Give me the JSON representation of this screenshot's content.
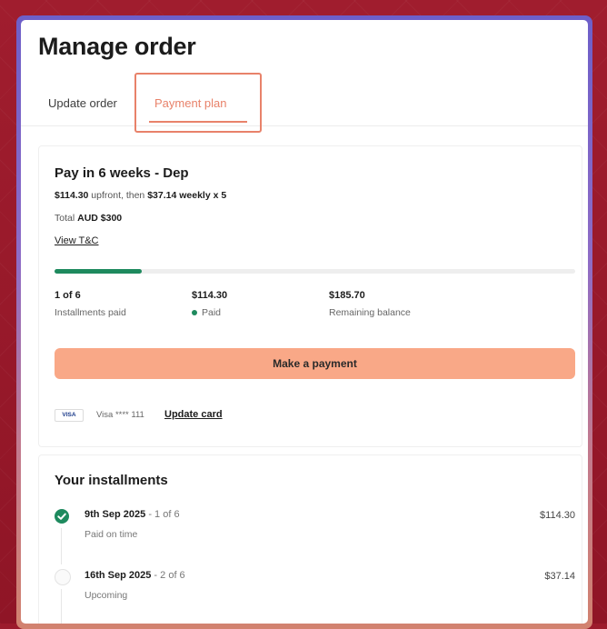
{
  "page": {
    "title": "Manage order"
  },
  "tabs": [
    {
      "label": "Update order",
      "active": false
    },
    {
      "label": "Payment plan",
      "active": true
    }
  ],
  "plan": {
    "title": "Pay in 6 weeks - Dep",
    "upfront_amount": "$114.30",
    "upfront_text": " upfront, then ",
    "weekly_text": "$37.14 weekly x 5",
    "total_prefix": "Total ",
    "total_value": "AUD $300",
    "tnc_link": "View T&C",
    "progress_fraction": 0.1667,
    "stats": [
      {
        "value": "1 of 6",
        "label": "Installments paid"
      },
      {
        "value": "$114.30",
        "label": "Paid"
      },
      {
        "value": "$185.70",
        "label": "Remaining balance"
      }
    ],
    "pay_button": "Make a payment",
    "card_brand": "VISA",
    "card_number": "Visa **** 111",
    "update_card_link": "Update card"
  },
  "installments": {
    "title": "Your installments",
    "items": [
      {
        "date": "9th Sep 2025",
        "sep": " - ",
        "count": "1 of 6",
        "status": "Paid on time",
        "amount": "$114.30",
        "paid": true
      },
      {
        "date": "16th Sep 2025",
        "sep": " - ",
        "count": "2 of 6",
        "status": "Upcoming",
        "amount": "$37.14",
        "paid": false
      }
    ]
  },
  "colors": {
    "accent": "#e8826a",
    "button": "#f9a887",
    "success": "#1e8a5e",
    "background": "#9c1b2c"
  },
  "icons": {
    "paid": "check-circle-icon",
    "upcoming": "empty-circle-icon"
  }
}
